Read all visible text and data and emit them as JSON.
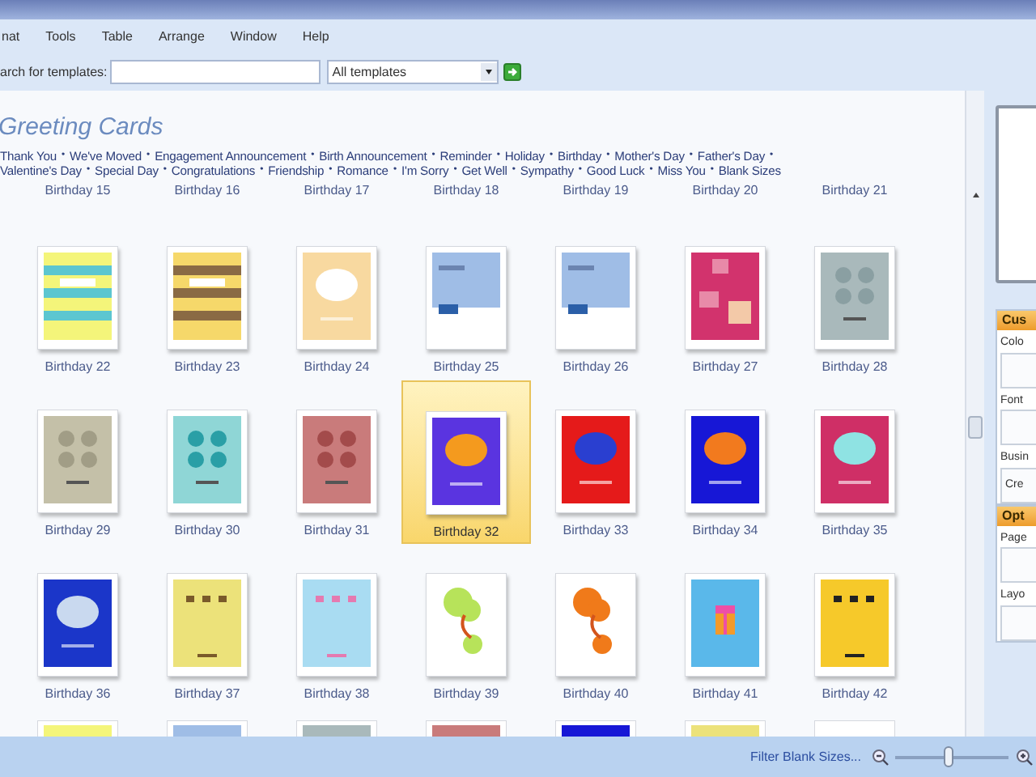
{
  "menu": [
    "nat",
    "Tools",
    "Table",
    "Arrange",
    "Window",
    "Help"
  ],
  "search": {
    "label": "arch for templates:",
    "filter": "All templates"
  },
  "heading": "Greeting Cards",
  "category_lines": [
    {
      "items": [
        "Thank You",
        "We've Moved",
        "Engagement Announcement",
        "Birth Announcement",
        "Reminder",
        "Holiday",
        "Birthday",
        "Mother's Day",
        "Father's Day"
      ],
      "trailing_separator": true
    },
    {
      "items": [
        "Valentine's Day",
        "Special Day",
        "Congratulations",
        "Friendship",
        "Romance",
        "I'm Sorry",
        "Get Well",
        "Sympathy",
        "Good Luck",
        "Miss You",
        "Blank Sizes"
      ],
      "trailing_separator": false
    }
  ],
  "separator": "•",
  "rows": [
    {
      "kind": "labels",
      "cards": [
        {
          "label": "Birthday 15"
        },
        {
          "label": "Birthday 16"
        },
        {
          "label": "Birthday 17"
        },
        {
          "label": "Birthday 18"
        },
        {
          "label": "Birthday 19"
        },
        {
          "label": "Birthday 20"
        },
        {
          "label": "Birthday 21"
        }
      ]
    },
    {
      "kind": "full",
      "cards": [
        {
          "label": "Birthday 22",
          "selected": false
        },
        {
          "label": "Birthday 23",
          "selected": false
        },
        {
          "label": "Birthday 24",
          "selected": false
        },
        {
          "label": "Birthday 25",
          "selected": false
        },
        {
          "label": "Birthday 26",
          "selected": false
        },
        {
          "label": "Birthday 27",
          "selected": false
        },
        {
          "label": "Birthday 28",
          "selected": false
        }
      ]
    },
    {
      "kind": "full",
      "cards": [
        {
          "label": "Birthday 29",
          "selected": false
        },
        {
          "label": "Birthday 30",
          "selected": false
        },
        {
          "label": "Birthday 31",
          "selected": false
        },
        {
          "label": "Birthday 32",
          "selected": true
        },
        {
          "label": "Birthday 33",
          "selected": false
        },
        {
          "label": "Birthday 34",
          "selected": false
        },
        {
          "label": "Birthday 35",
          "selected": false
        }
      ]
    },
    {
      "kind": "full",
      "cards": [
        {
          "label": "Birthday 36",
          "selected": false
        },
        {
          "label": "Birthday 37",
          "selected": false
        },
        {
          "label": "Birthday 38",
          "selected": false
        },
        {
          "label": "Birthday 39",
          "selected": false
        },
        {
          "label": "Birthday 40",
          "selected": false
        },
        {
          "label": "Birthday 41",
          "selected": false
        },
        {
          "label": "Birthday 42",
          "selected": false
        }
      ]
    },
    {
      "kind": "thumbnails"
    }
  ],
  "side_pane": {
    "sections": [
      {
        "title": "Cus",
        "fields": [
          {
            "label": "Colo"
          },
          {
            "label": "Font"
          },
          {
            "label": "Busin",
            "value": "Cre"
          }
        ]
      },
      {
        "title": "Opt",
        "fields": [
          {
            "label": "Page"
          },
          {
            "label": "Layo"
          }
        ]
      }
    ]
  },
  "status_bar": {
    "filter_link": "Filter Blank Sizes...",
    "zoom": {
      "level": 0.47
    }
  }
}
